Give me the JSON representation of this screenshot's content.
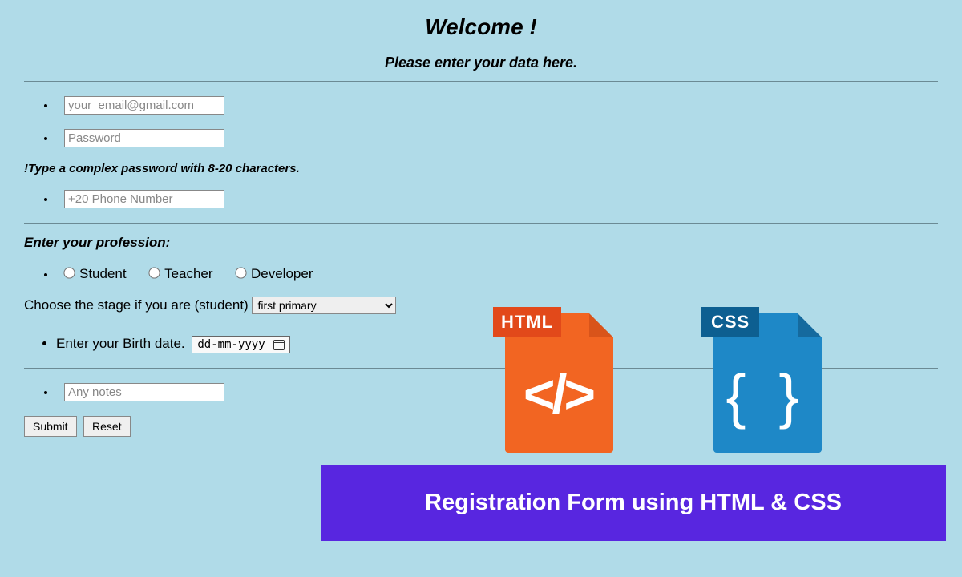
{
  "header": {
    "welcome": "Welcome !",
    "subtitle": "Please enter your data here."
  },
  "form": {
    "email_placeholder": "your_email@gmail.com",
    "password_placeholder": "Password",
    "password_hint": "!Type a complex password with 8-20 characters.",
    "phone_placeholder": "+20 Phone Number",
    "profession_label": "Enter your profession:",
    "professions": {
      "student": "Student",
      "teacher": "Teacher",
      "developer": "Developer"
    },
    "stage_label": "Choose the stage if you are (student)",
    "stage_selected": "first primary",
    "birth_label": "Enter your Birth date.",
    "birth_placeholder": "dd-mm-yyyy",
    "notes_placeholder": "Any notes",
    "submit_label": "Submit",
    "reset_label": "Reset"
  },
  "icons": {
    "html_label": "HTML",
    "html_symbol": "</>",
    "css_label": "CSS",
    "css_symbol": "{ }"
  },
  "banner": {
    "text": "Registration Form using HTML & CSS"
  }
}
